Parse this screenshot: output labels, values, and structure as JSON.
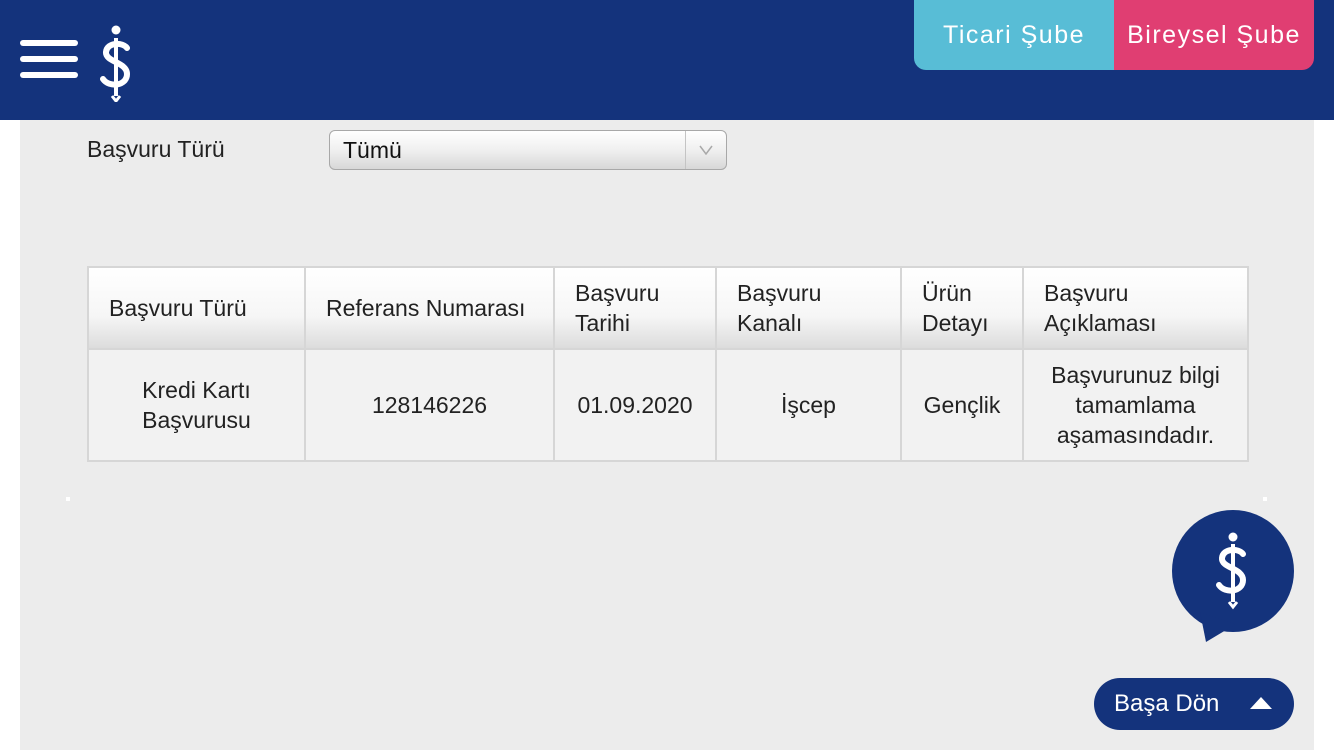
{
  "header": {
    "menu_icon": "hamburger-menu-icon",
    "logo_icon": "isbank-logo-icon",
    "tabs": [
      {
        "label": "Ticari Şube",
        "color": "#58bdd6"
      },
      {
        "label": "Bireysel Şube",
        "color": "#e03e72"
      }
    ],
    "background_color": "#14337c"
  },
  "filter": {
    "label": "Başvuru Türü",
    "selected_value": "Tümü",
    "dropdown_icon": "chevron-down-icon"
  },
  "table": {
    "columns": [
      "Başvuru Türü",
      "Referans Numarası",
      "Başvuru Tarihi",
      "Başvuru Kanalı",
      "Ürün Detayı",
      "Başvuru Açıklaması"
    ],
    "rows": [
      {
        "type": "Kredi Kartı Başvurusu",
        "reference": "128146226",
        "date": "01.09.2020",
        "channel": "İşcep",
        "product": "Gençlik",
        "description": "Başvurunuz bilgi tamamlama aşamasındadır."
      }
    ]
  },
  "chat": {
    "icon": "isbank-chat-bubble-icon"
  },
  "back_to_top": {
    "label": "Başa Dön",
    "icon": "arrow-up-icon"
  }
}
